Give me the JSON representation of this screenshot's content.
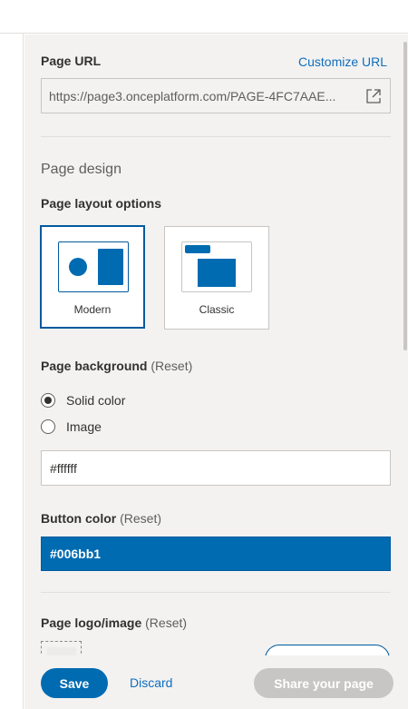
{
  "page_url": {
    "label": "Page URL",
    "customize_link": "Customize URL",
    "value": "https://page3.onceplatform.com/PAGE-4FC7AAE..."
  },
  "page_design": {
    "title": "Page design",
    "layout_label": "Page layout options",
    "layouts": [
      {
        "name": "Modern",
        "selected": true
      },
      {
        "name": "Classic",
        "selected": false
      }
    ]
  },
  "background": {
    "label": "Page background",
    "reset": "(Reset)",
    "options": [
      {
        "label": "Solid color",
        "selected": true
      },
      {
        "label": "Image",
        "selected": false
      }
    ],
    "value": "#ffffff"
  },
  "button_color": {
    "label": "Button color",
    "reset": "(Reset)",
    "value": "#006bb1"
  },
  "logo": {
    "label": "Page logo/image",
    "reset": "(Reset)"
  },
  "footer": {
    "save": "Save",
    "discard": "Discard",
    "share": "Share your page"
  },
  "colors": {
    "accent": "#006bb1",
    "link": "#106ebe",
    "panel_bg": "#f3f2f1",
    "disabled": "#c8c6c4"
  },
  "icons": {
    "open_url": "open-in-new-window-icon"
  }
}
